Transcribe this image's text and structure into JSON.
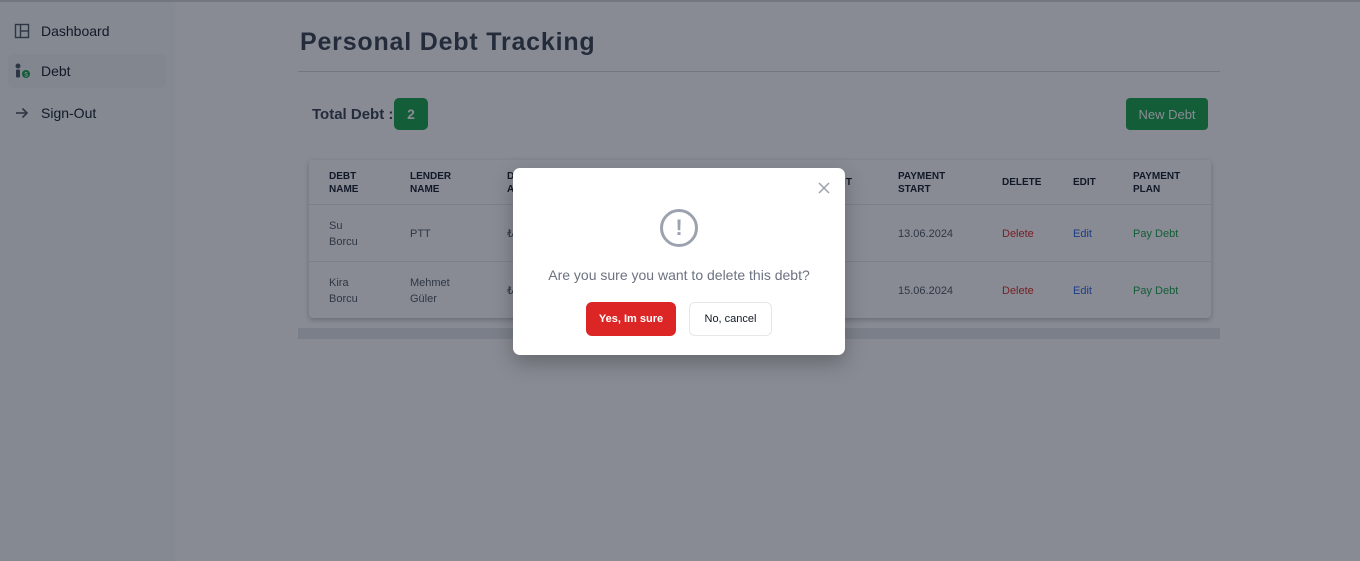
{
  "sidebar": {
    "items": [
      {
        "label": "Dashboard",
        "icon": "dashboard-icon"
      },
      {
        "label": "Debt",
        "icon": "debt-user-icon"
      },
      {
        "label": "Sign-Out",
        "icon": "arrow-right-icon"
      }
    ]
  },
  "main": {
    "title": "Personal Debt Tracking",
    "total_label": "Total Debt :",
    "total_count": "2",
    "new_debt_label": "New Debt"
  },
  "table": {
    "headers": [
      {
        "line1": "DEBT",
        "line2": "NAME"
      },
      {
        "line1": "LENDER",
        "line2": "NAME"
      },
      {
        "line1": "D",
        "line2": "A"
      },
      {
        "line1": "ENT",
        "line2": ""
      },
      {
        "line1": "PAYMENT",
        "line2": "START"
      },
      {
        "line1": "DELETE",
        "line2": ""
      },
      {
        "line1": "EDIT",
        "line2": ""
      },
      {
        "line1": "PAYMENT",
        "line2": "PLAN"
      }
    ],
    "rows": [
      {
        "name1": "Su",
        "name2": "Borcu",
        "lender1": "PTT",
        "lender2": "",
        "amount": "₺",
        "start": "13.06.2024",
        "delete": "Delete",
        "edit": "Edit",
        "pay": "Pay Debt"
      },
      {
        "name1": "Kira",
        "name2": "Borcu",
        "lender1": "Mehmet",
        "lender2": "Güler",
        "amount": "₺",
        "start": "15.06.2024",
        "delete": "Delete",
        "edit": "Edit",
        "pay": "Pay Debt"
      }
    ]
  },
  "modal": {
    "message": "Are you sure you want to delete this debt?",
    "confirm_label": "Yes, Im sure",
    "cancel_label": "No, cancel",
    "close_icon": "close-icon",
    "warning_icon": "warning-icon"
  },
  "colors": {
    "accent_green": "#16a34a",
    "danger_red": "#dc2626",
    "link_blue": "#2563eb"
  }
}
